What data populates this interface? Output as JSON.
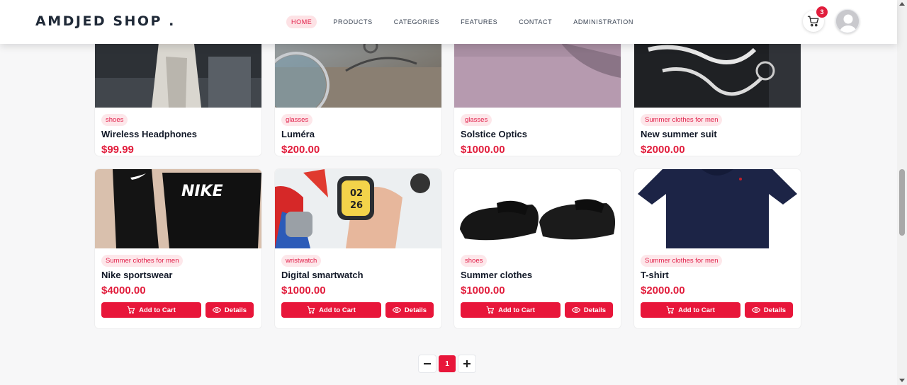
{
  "header": {
    "logo": "AMDJED SHOP .",
    "nav": [
      "HOME",
      "PRODUCTS",
      "CATEGORIES",
      "FEATURES",
      "CONTACT",
      "ADMINISTRATION"
    ],
    "active_nav": "HOME",
    "cart_count": "3",
    "cart_icon": "cart-icon",
    "avatar_icon": "user-avatar-icon"
  },
  "buttons": {
    "add_to_cart": "Add to Cart",
    "details": "Details"
  },
  "products": [
    {
      "tag": "shoes",
      "name": "Wireless Headphones",
      "price": "$99.99"
    },
    {
      "tag": "glasses",
      "name": "Luméra",
      "price": "$200.00"
    },
    {
      "tag": "glasses",
      "name": "Solstice Optics",
      "price": "$1000.00"
    },
    {
      "tag": "Summer clothes for men",
      "name": "New summer suit",
      "price": "$2000.00"
    },
    {
      "tag": "Summer clothes for men",
      "name": "Nike sportswear",
      "price": "$4000.00"
    },
    {
      "tag": "wristwatch",
      "name": "Digital smartwatch",
      "price": "$1000.00"
    },
    {
      "tag": "shoes",
      "name": "Summer clothes",
      "price": "$1000.00"
    },
    {
      "tag": "Summer clothes for men",
      "name": "T-shirt",
      "price": "$2000.00"
    }
  ],
  "image_text": {
    "nike_logo": "NIKE",
    "watch_hour": "02",
    "watch_min": "26"
  },
  "pagination": {
    "current": "1",
    "prev_icon": "minus-icon",
    "next_icon": "plus-icon"
  },
  "colors": {
    "accent": "#e8163a",
    "tag_bg": "#fde7ea"
  }
}
